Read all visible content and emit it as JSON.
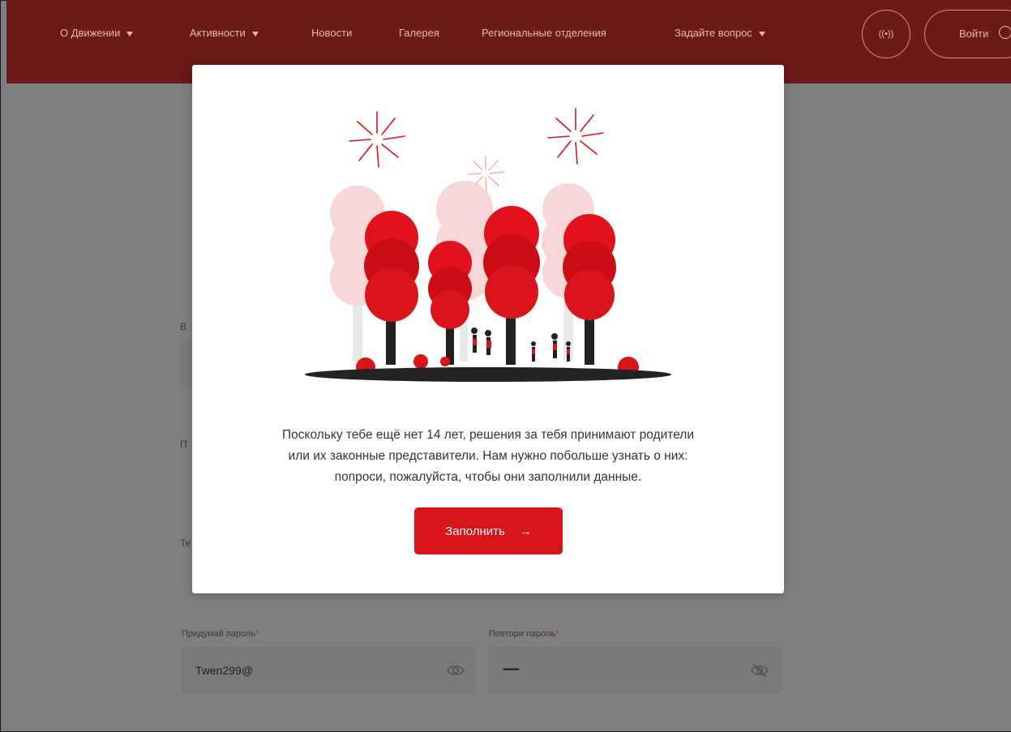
{
  "header": {
    "nav": [
      {
        "label": "О Движении",
        "has_caret": true
      },
      {
        "label": "Активности",
        "has_caret": true
      },
      {
        "label": "Новости",
        "has_caret": false
      },
      {
        "label": "Галерея",
        "has_caret": false
      },
      {
        "label": "Региональные отделения",
        "has_caret": false
      },
      {
        "label": "Задайте вопрос",
        "has_caret": true
      }
    ],
    "radio_label": "((•))",
    "login_label": "Войти"
  },
  "form": {
    "partial_labels": [
      "В",
      "П",
      "Те"
    ],
    "password": {
      "label": "Придумай пароль",
      "value": "Twen299@"
    },
    "password_repeat": {
      "label": "Повтори пароль",
      "value": "••••••••"
    },
    "required_mark": "*"
  },
  "modal": {
    "message_lines": [
      "Поскольку тебе ещё нет 14 лет, решения за тебя принимают родители",
      "или их законные представители. Нам нужно побольше узнать о них:",
      "попроси, пожалуйста, чтобы они заполнили данные."
    ],
    "button_label": "Заполнить",
    "button_arrow": "→"
  },
  "colors": {
    "header_bg": "#6b1a17",
    "accent_red": "#d9141b",
    "overlay": "#7f7f7f"
  }
}
